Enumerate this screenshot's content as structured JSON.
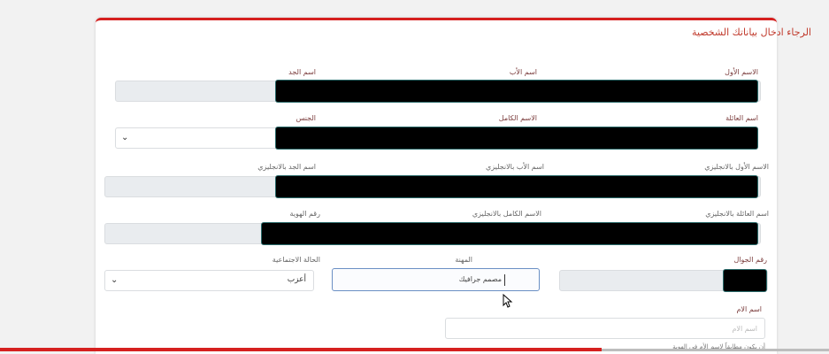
{
  "form": {
    "title": "الرجاء ادخال بياناتك الشخصية",
    "row1": {
      "first_name": "الاسم الأول",
      "father_name": "اسم الأب",
      "grandfather_name": "اسم الجد"
    },
    "row2": {
      "family_name": "اسم العائلة",
      "full_name": "الاسم الكامل",
      "gender": "الجنس"
    },
    "row3": {
      "first_name_en": "الاسم الأول بالانجليزي",
      "father_name_en": "اسم الأب بالانجليزي",
      "grandfather_name_en": "اسم الجد بالانجليزي"
    },
    "row4": {
      "family_name_en": "اسم العائلة بالانجليزي",
      "full_name_en": "الاسم الكامل بالانجليزي",
      "id_number": "رقم الهوية"
    },
    "row5": {
      "mobile": "رقم الجوال",
      "job": "المهنة",
      "job_value": "مصمم جرافيك",
      "marital_status": "الحالة الاجتماعية",
      "marital_status_value": "أعزب"
    },
    "row6": {
      "mother_name": "اسم الام",
      "mother_name_placeholder": "اسم الام",
      "note": "أن يكون مطابقاً لاسم الأم في الهوية"
    }
  },
  "colors": {
    "accent": "#d6201f",
    "label": "#7a3b3b",
    "focus_border": "#6a8fc4"
  },
  "icons": {
    "dropdown": "chevron-down-icon",
    "cursor": "mouse-pointer-icon"
  }
}
